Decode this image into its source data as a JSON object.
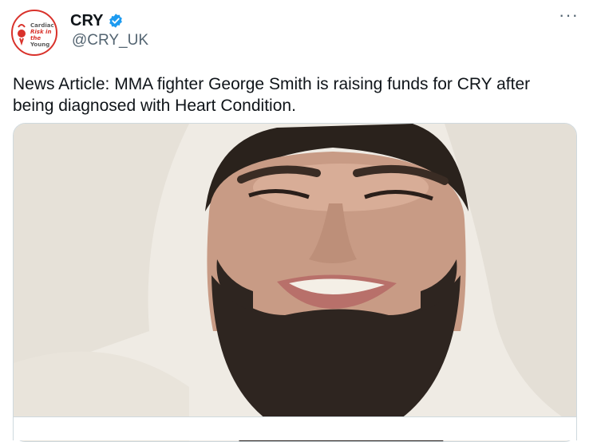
{
  "tweet": {
    "display_name": "CRY",
    "handle": "@CRY_UK",
    "verified": true,
    "more_icon": "more-horizontal-icon",
    "text": "News Article: MMA fighter George Smith is raising funds for CRY after being diagnosed with Heart Condition.",
    "avatar_logo_text": [
      "Cardiac",
      "Risk in the",
      "Young"
    ]
  },
  "colors": {
    "brand_red": "#d9322b",
    "verified_blue": "#1d9bf0",
    "text_primary": "#0f1419",
    "text_secondary": "#536471",
    "border": "#cfd9de"
  }
}
